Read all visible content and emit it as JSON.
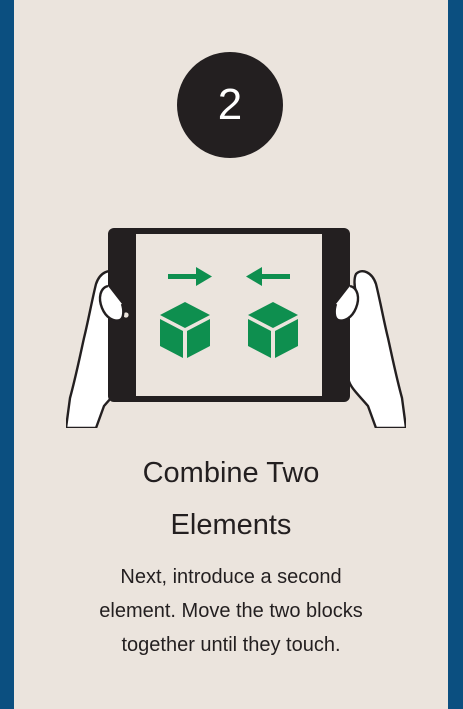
{
  "step": {
    "number": "2"
  },
  "title": {
    "line1": "Combine Two",
    "line2": "Elements"
  },
  "description": {
    "line1": "Next, introduce a second",
    "line2": "element. Move the two blocks",
    "line3": "together until they touch."
  },
  "colors": {
    "background": "#0b4f80",
    "card": "#ebe4dd",
    "badge": "#231f20",
    "accent_green": "#0e8f4f",
    "tablet": "#231f20"
  },
  "icons": {
    "illustration": "hands-holding-tablet-icon",
    "arrow_right": "arrow-right-icon",
    "arrow_left": "arrow-left-icon",
    "block": "cube-icon"
  }
}
